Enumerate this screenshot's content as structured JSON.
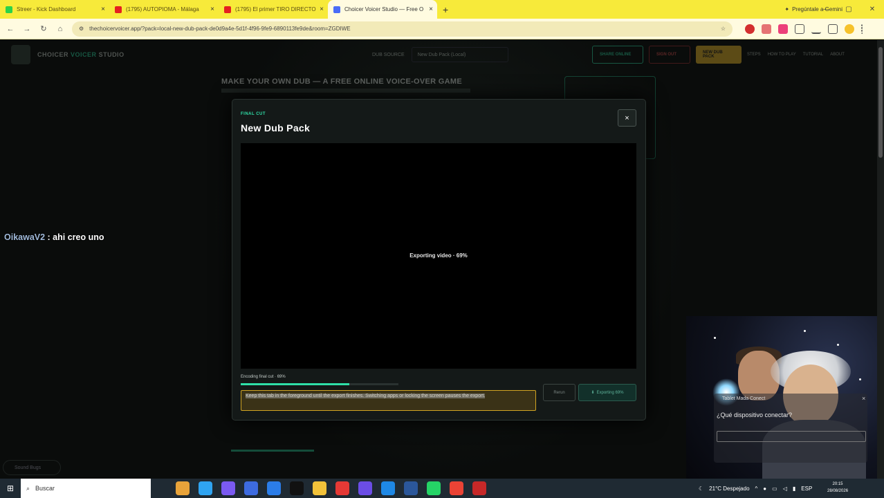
{
  "browser": {
    "tabs": [
      {
        "label": "Streer - Kick Dashboard",
        "color": "#2bd24a",
        "active": false
      },
      {
        "label": "(1795) AUTOPIOMA - Málaga",
        "color": "#e52020",
        "active": false
      },
      {
        "label": "(1795) El primer TIRO DIRECTO",
        "color": "#e52020",
        "active": false
      },
      {
        "label": "Choicer Voicer Studio — Free O",
        "color": "#4a6cf7",
        "active": true
      }
    ],
    "new_tab": "+",
    "gemini": "Pregúntale a Gemini",
    "url": "thechoicervoicer.app/?pack=local-new-dub-pack-de0d9a4e-5d1f-4f96-9fe9-6890113fe9de&room=ZGDIWE"
  },
  "app": {
    "brand_a": "CHOICER",
    "brand_b": "VOICER",
    "brand_c": "STUDIO",
    "header_label": "DUB SOURCE",
    "pack_select": "New Dub Pack (Local)",
    "btn_green": "SHARE ONLINE",
    "btn_red": "SIGN OUT",
    "btn_yellow": "NEW DUB PACK",
    "links": [
      "STEPS",
      "HOW TO PLAY",
      "TUTORIAL",
      "ABOUT"
    ],
    "bg_title": "MAKE YOUR OWN DUB — A FREE ONLINE VOICE-OVER GAME",
    "sounds_label": "Sound Bugs"
  },
  "chat": {
    "user": "OikawaV2",
    "message": " : ahi creo uno"
  },
  "modal": {
    "eyebrow": "FINAL CUT",
    "title": "New Dub Pack",
    "close": "×",
    "video_status": "Exporting video · 69%",
    "encoding_label": "Encoding final cut · 69%",
    "progress": 0.69,
    "warning": "Keep this tab in the foreground until the export finishes. Switching apps or locking the screen pauses the export.",
    "btn_rerecord": "Rerun",
    "btn_export": "Exporting 69%"
  },
  "overlay": {
    "dialog_title": "Tablet Mada Conect",
    "dialog_question": "¿Qué dispositivo conectar?",
    "dialog_close": "×"
  },
  "taskbar": {
    "search_placeholder": "Buscar",
    "weather": "21°C  Despejado",
    "lang": "ESP",
    "time": "20:15",
    "date": "28/08/2026",
    "icon_colors": [
      "#e8a33a",
      "#2fa4f2",
      "#7a5af2",
      "#3d6be0",
      "#2b7de9",
      "#111111",
      "#f2c23a",
      "#e53935",
      "#6b4de6",
      "#1e88e5",
      "#2b579a",
      "#25d366",
      "#ea4335",
      "#c62828"
    ]
  }
}
